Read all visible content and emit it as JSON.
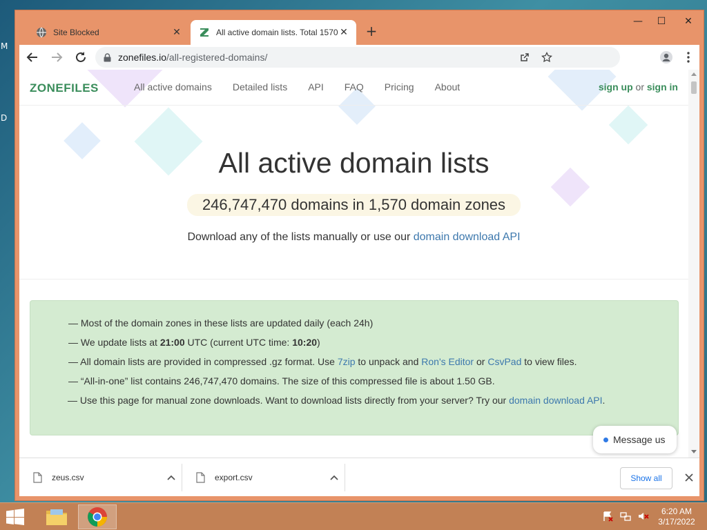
{
  "desktop": {
    "letters": [
      "M",
      "D"
    ]
  },
  "window": {
    "controls": {
      "minimize": "—",
      "maximize": "☐",
      "close": "✕"
    }
  },
  "tabs": [
    {
      "title": "Site Blocked",
      "icon": "globe-icon",
      "close": "✕"
    },
    {
      "title": "All active domain lists. Total 1570",
      "icon": "zonefiles-favicon",
      "close": "✕"
    }
  ],
  "new_tab": "+",
  "toolbar": {
    "url_host": "zonefiles.io",
    "url_path": "/all-registered-domains/"
  },
  "site_nav": {
    "logo": "ZONEFILES",
    "links": [
      "All active domains",
      "Detailed lists",
      "API",
      "FAQ",
      "Pricing",
      "About"
    ],
    "sign_up": "sign up",
    "or": "or",
    "sign_in": "sign in"
  },
  "hero": {
    "title": "All active domain lists",
    "subtitle": "246,747,470 domains in 1,570 domain zones",
    "desc_prefix": "Download any of the lists manually or use our ",
    "desc_link": "domain download API"
  },
  "info": {
    "line1": "— Most of the domain zones in these lists are updated daily (each 24h)",
    "line2_a": "— We update lists at ",
    "line2_b": "21:00",
    "line2_c": " UTC (current UTC time: ",
    "line2_d": "10:20",
    "line2_e": ")",
    "line3_a": "— All domain lists are provided in compressed .gz format. Use ",
    "line3_link1": "7zip",
    "line3_b": " to unpack and ",
    "line3_link2": "Ron's Editor",
    "line3_c": " or ",
    "line3_link3": "CsvPad",
    "line3_d": " to view files.",
    "line4": "— “All-in-one” list contains 246,747,470 domains. The size of this compressed file is about 1.50 GB.",
    "line5_a": "— Use this page for manual zone downloads. Want to download lists directly from your server? Try our ",
    "line5_link": "domain download API",
    "line5_b": "."
  },
  "message_button": "Message us",
  "downloads": {
    "items": [
      {
        "name": "zeus.csv"
      },
      {
        "name": "export.csv"
      }
    ],
    "show_all": "Show all"
  },
  "taskbar": {
    "time": "6:20 AM",
    "date": "3/17/2022"
  },
  "colors": {
    "brand_green": "#3a8d5b",
    "link_blue": "#3d78ad",
    "info_bg": "#d4ebd1",
    "window_frame": "#e8946a"
  }
}
